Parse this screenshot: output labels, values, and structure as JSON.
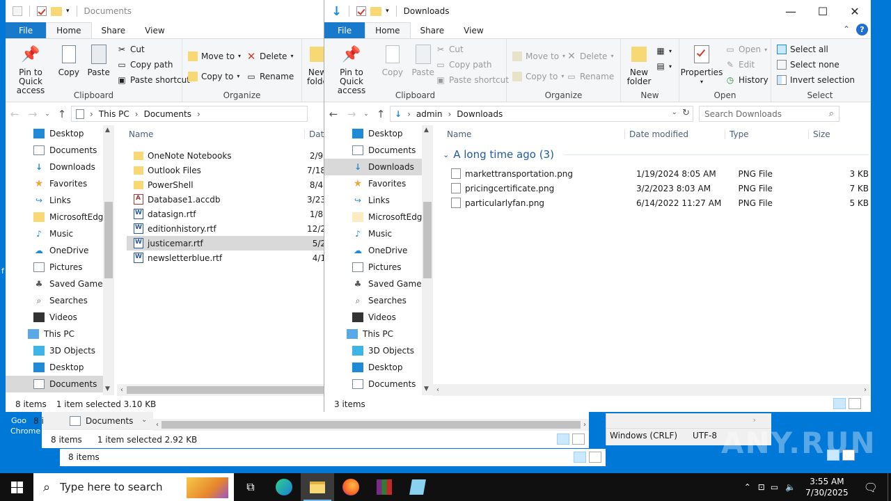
{
  "desktop": {
    "partial_label_1": "Goo",
    "partial_label_2": "Chrome",
    "partial_label_3": "f"
  },
  "back_window": {
    "title": "Documents",
    "tabs": [
      "File",
      "Home",
      "Share",
      "View"
    ],
    "clipboard": {
      "pin_label": "Pin to Quick access",
      "copy_label": "Copy",
      "paste_label": "Paste",
      "cut_label": "Cut",
      "copy_path_label": "Copy path",
      "paste_shortcut_label": "Paste shortcut",
      "group_label": "Clipboard"
    },
    "organize": {
      "move_to_label": "Move to",
      "copy_to_label": "Copy to",
      "delete_label": "Delete",
      "rename_label": "Rename",
      "group_label": "Organize"
    },
    "new_folder_partial": "New folde",
    "breadcrumb": [
      "This PC",
      "Documents"
    ],
    "nav_items": [
      "Desktop",
      "Documents",
      "Downloads",
      "Favorites",
      "Links",
      "MicrosoftEdge",
      "Music",
      "OneDrive",
      "Pictures",
      "Saved Games",
      "Searches",
      "Videos",
      "This PC",
      "3D Objects",
      "Desktop",
      "Documents"
    ],
    "columns": {
      "name": "Name",
      "date_partial": "Dat"
    },
    "files": [
      {
        "name": "OneNote Notebooks",
        "date": "2/9,",
        "icon": "folder"
      },
      {
        "name": "Outlook Files",
        "date": "7/18",
        "icon": "folder"
      },
      {
        "name": "PowerShell",
        "date": "8/4,",
        "icon": "folder"
      },
      {
        "name": "Database1.accdb",
        "date": "3/23",
        "icon": "access"
      },
      {
        "name": "datasign.rtf",
        "date": "1/8,",
        "icon": "word"
      },
      {
        "name": "editionhistory.rtf",
        "date": "12/2",
        "icon": "word"
      },
      {
        "name": "justicemar.rtf",
        "date": "5/2",
        "icon": "word",
        "selected": true
      },
      {
        "name": "newsletterblue.rtf",
        "date": "4/1",
        "icon": "word"
      }
    ],
    "status_count": "8 items",
    "status_selected": "1 item selected  3.10 KB"
  },
  "behind_window_2": {
    "nav_label": "Documents",
    "status_count": "8 items",
    "status_selected": "1 item selected  2.92 KB",
    "partial_left": "8 i"
  },
  "behind_window_3": {
    "status_count": "8 items"
  },
  "notepad_strip": {
    "line_ending": "Windows (CRLF)",
    "encoding": "UTF-8"
  },
  "front_window": {
    "title": "Downloads",
    "tabs": [
      "File",
      "Home",
      "Share",
      "View"
    ],
    "clipboard": {
      "pin_label": "Pin to Quick access",
      "copy_label": "Copy",
      "paste_label": "Paste",
      "cut_label": "Cut",
      "copy_path_label": "Copy path",
      "paste_shortcut_label": "Paste shortcut",
      "group_label": "Clipboard"
    },
    "organize": {
      "move_to_label": "Move to",
      "copy_to_label": "Copy to",
      "delete_label": "Delete",
      "rename_label": "Rename",
      "group_label": "Organize"
    },
    "new": {
      "new_folder_label": "New folder",
      "group_label": "New"
    },
    "open": {
      "properties_label": "Properties",
      "open_label": "Open",
      "edit_label": "Edit",
      "history_label": "History",
      "group_label": "Open"
    },
    "select": {
      "select_all_label": "Select all",
      "select_none_label": "Select none",
      "invert_label": "Invert selection",
      "group_label": "Select"
    },
    "breadcrumb": [
      "admin",
      "Downloads"
    ],
    "search_placeholder": "Search Downloads",
    "nav_items": [
      "Desktop",
      "Documents",
      "Downloads",
      "Favorites",
      "Links",
      "MicrosoftEdge",
      "Music",
      "OneDrive",
      "Pictures",
      "Saved Games",
      "Searches",
      "Videos",
      "This PC",
      "3D Objects",
      "Desktop",
      "Documents"
    ],
    "columns": {
      "name": "Name",
      "date": "Date modified",
      "type": "Type",
      "size": "Size"
    },
    "group_header": "A long time ago (3)",
    "files": [
      {
        "name": "markettransportation.png",
        "date": "1/19/2024 8:05 AM",
        "type": "PNG File",
        "size": "3 KB"
      },
      {
        "name": "pricingcertificate.png",
        "date": "3/2/2023 8:03 AM",
        "type": "PNG File",
        "size": "7 KB"
      },
      {
        "name": "particularlyfan.png",
        "date": "6/14/2022 11:27 AM",
        "type": "PNG File",
        "size": "5 KB"
      }
    ],
    "status_count": "3 items"
  },
  "taskbar": {
    "search_placeholder": "Type here to search",
    "time": "3:55 AM",
    "date": "7/30/2025"
  },
  "watermark": "ANY.RUN",
  "colors": {
    "accent": "#0078d7",
    "file_tab": "#1979ca",
    "selection": "#cce8ff"
  }
}
